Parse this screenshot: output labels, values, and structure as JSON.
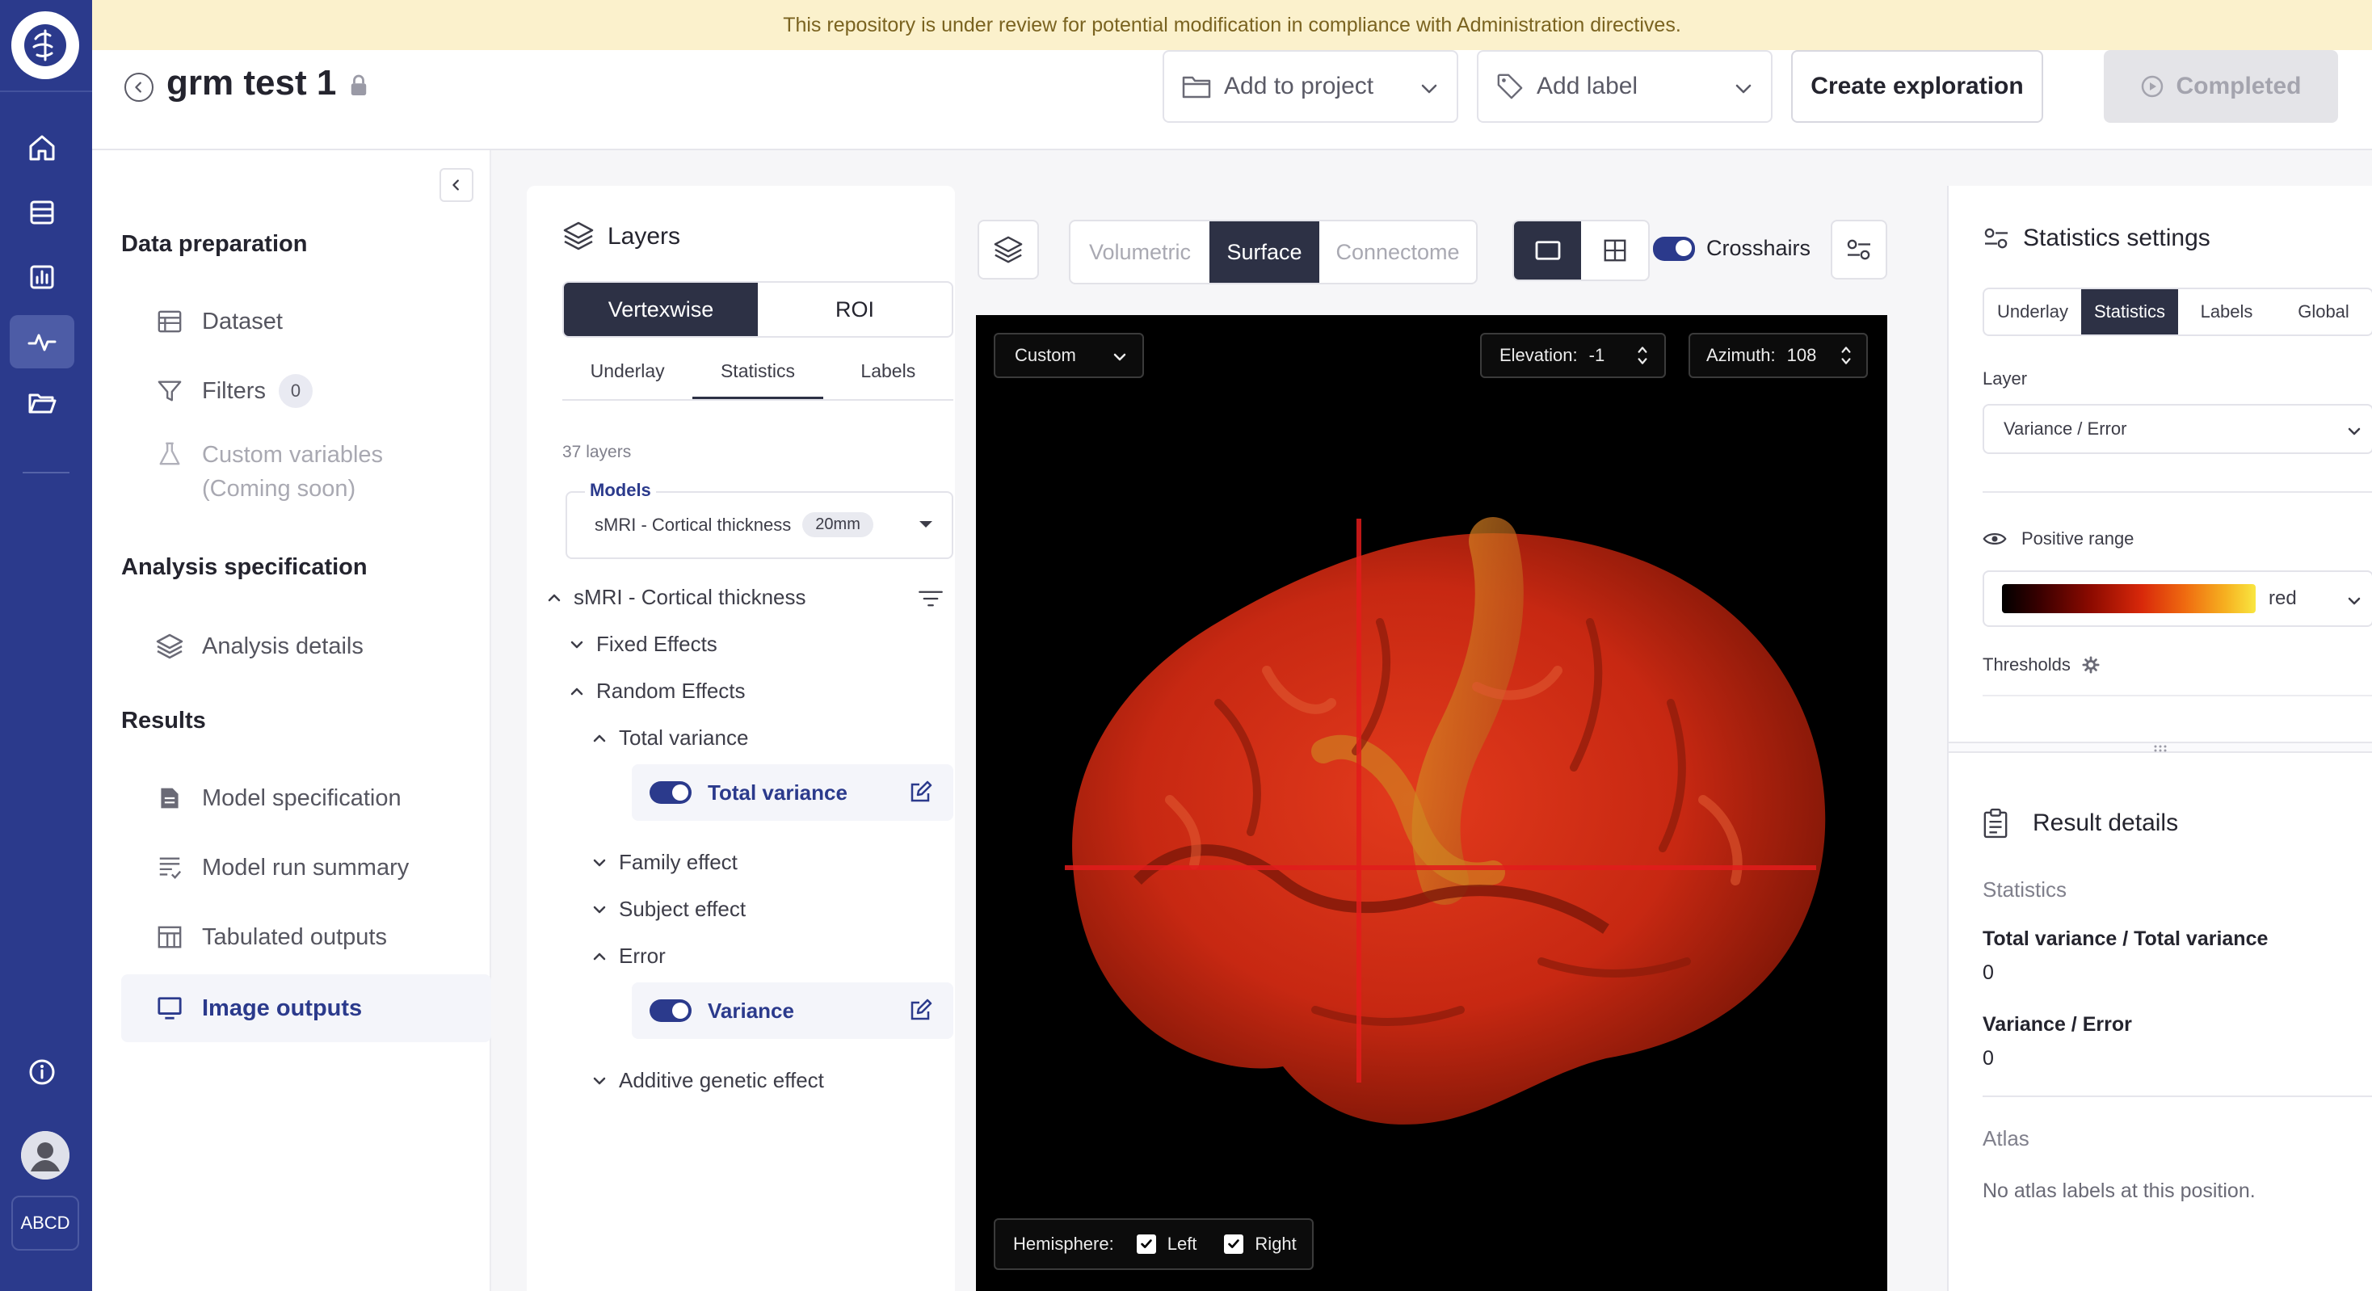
{
  "banner": "This repository is under review for potential modification in compliance with Administration directives.",
  "header": {
    "title": "grm test 1",
    "add_to_project": "Add to project",
    "add_label": "Add label",
    "create_exploration": "Create exploration",
    "completed": "Completed"
  },
  "rail": {
    "org": "ABCD"
  },
  "nav": {
    "data_preparation": "Data preparation",
    "dataset": "Dataset",
    "filters": "Filters",
    "filters_count": "0",
    "custom_variables_1": "Custom variables",
    "custom_variables_2": "(Coming soon)",
    "analysis_specification": "Analysis specification",
    "analysis_details": "Analysis details",
    "results": "Results",
    "model_specification": "Model specification",
    "model_run_summary": "Model run summary",
    "tabulated_outputs": "Tabulated outputs",
    "image_outputs": "Image outputs"
  },
  "layers": {
    "title": "Layers",
    "mode_tabs": [
      "Vertexwise",
      "ROI"
    ],
    "sub_tabs": [
      "Underlay",
      "Statistics",
      "Labels"
    ],
    "count": "37 layers",
    "models_label": "Models",
    "models_value": "sMRI - Cortical thickness",
    "models_chip": "20mm",
    "tree": {
      "root": "sMRI - Cortical thickness",
      "fixed": "Fixed Effects",
      "random": "Random Effects",
      "total_variance": "Total variance",
      "total_variance_layer": "Total variance",
      "family": "Family effect",
      "subject": "Subject effect",
      "error": "Error",
      "variance_layer": "Variance",
      "additive": "Additive genetic effect"
    }
  },
  "viewer": {
    "space_tabs": [
      "Volumetric",
      "Surface",
      "Connectome"
    ],
    "crosshairs": "Crosshairs",
    "camera_preset": "Custom",
    "elevation_label": "Elevation:",
    "elevation_value": "-1",
    "azimuth_label": "Azimuth:",
    "azimuth_value": "108",
    "hemisphere_label": "Hemisphere:",
    "left": "Left",
    "right": "Right"
  },
  "stats": {
    "title": "Statistics settings",
    "tabs": [
      "Underlay",
      "Statistics",
      "Labels",
      "Global"
    ],
    "layer_label": "Layer",
    "layer_value": "Variance / Error",
    "positive_range": "Positive range",
    "colormap": "red",
    "thresholds": "Thresholds"
  },
  "result": {
    "title": "Result details",
    "statistics": "Statistics",
    "r1_label": "Total variance / Total variance",
    "r1_value": "0",
    "r2_label": "Variance / Error",
    "r2_value": "0",
    "atlas": "Atlas",
    "atlas_text": "No atlas labels at this position."
  }
}
